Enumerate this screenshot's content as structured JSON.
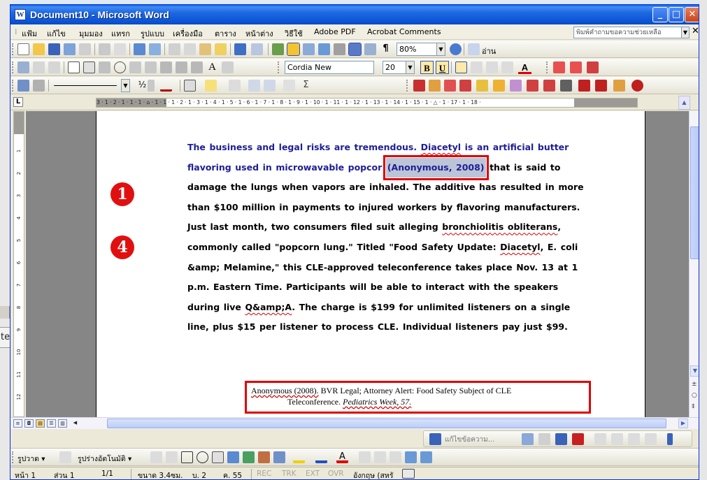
{
  "window": {
    "title": "Document10 - Microsoft Word"
  },
  "menu": {
    "items": [
      "แฟ้ม",
      "แก้ไข",
      "มุมมอง",
      "แทรก",
      "รูปแบบ",
      "เครื่องมือ",
      "ตาราง",
      "หน้าต่าง",
      "วิธีใช้",
      "Adobe PDF",
      "Acrobat Comments"
    ],
    "help_placeholder": "พิมพ์คำถามขอความช่วยเหลือ"
  },
  "standard_toolbar": {
    "zoom": "80%",
    "read_label": "อ่าน"
  },
  "formatting_toolbar": {
    "font_name": "Cordia New",
    "font_size": "20",
    "bold_label": "B",
    "underline_label": "U",
    "font_color_label": "A"
  },
  "drawing_tables_toolbar": {
    "fraction_label": "½",
    "sum_label": "Σ"
  },
  "ruler": {
    "horizontal_text": "3 · 1 · 2 · 1 · 1 · 1 · ⌂ · 1 · 1 · 1 · 2 · 1 · 3 · 1 · 4 · 1 · 5 · 1 · 6 · 1 · 7 · 1 · 8 · 1 · 9 · 1 · 10 · 1 · 11 · 1 · 12 · 1 · 13 · 1 · 14 · 1 · 15 · 1 · △ · 1 · 17 · 1 · 18 ·",
    "vertical_ticks": [
      "1",
      "2",
      "3",
      "4",
      "5",
      "6",
      "7",
      "8",
      "9",
      "10",
      "11",
      "12"
    ]
  },
  "document": {
    "para_blue_1": "The business and legal risks are tremendous. ",
    "para_blue_diacetyl": "Diacetyl",
    "para_blue_2": " is an artificial butter flavoring used in microwavable popcor",
    "citation": "(Anonymous, 2008)",
    "para_rest_1": " that is said to damage the lungs when vapors are inhaled. The additive has resulted in more than $100 million in payments to injured workers by flavoring manufacturers. Just last month, two consumers filed suit alleging ",
    "para_spell_bronch": "bronchiolitis obliterans",
    "para_rest_2": ", commonly called \"popcorn lung.\" Titled \"Food Safety Update: ",
    "para_spell_diacetyl2": "Diacetyl",
    "para_rest_3": ", E. coli &amp; Melamine,\" this CLE-approved teleconference takes place Nov. 13 at 1 p.m. Eastern Time. Participants will be able to interact with the speakers during live ",
    "para_spell_qa": "Q&amp;A",
    "para_rest_4": ". The charge is $199 for unlimited listeners on a single line, plus $15 per listener to process CLE. Individual listeners pay just $99.",
    "callout_1": "❶",
    "callout_4": "❹",
    "reference_author": "Anonymous (2008).",
    "reference_rest": " BVR Legal; Attorney Alert: Food Safety Subject of CLE",
    "reference_line2_a": "Teleconference. ",
    "reference_journal": "Pediatrics Week, 57."
  },
  "review_toolbar": {
    "edit_label": "แก้ไขข้อความ..."
  },
  "drawing_toolbar": {
    "draw_label": "รูปวาด ▾",
    "autoshapes_label": "รูปร่างอัตโนมัติ ▾"
  },
  "status": {
    "page": "หน้า 1",
    "section": "ส่วน 1",
    "page_of": "1/1",
    "position": "ขนาด 3.4ซม.",
    "line": "บ. 2",
    "column": "ค. 55",
    "rec": "REC",
    "trk": "TRK",
    "ext": "EXT",
    "ovr": "OVR",
    "language": "อังกฤษ (สหรั"
  },
  "backdrop": {
    "peek_text": "te"
  },
  "colors": {
    "title_bar": "#0a55d6",
    "highlight_red": "#e00000",
    "body_blue": "#1e1e96"
  }
}
